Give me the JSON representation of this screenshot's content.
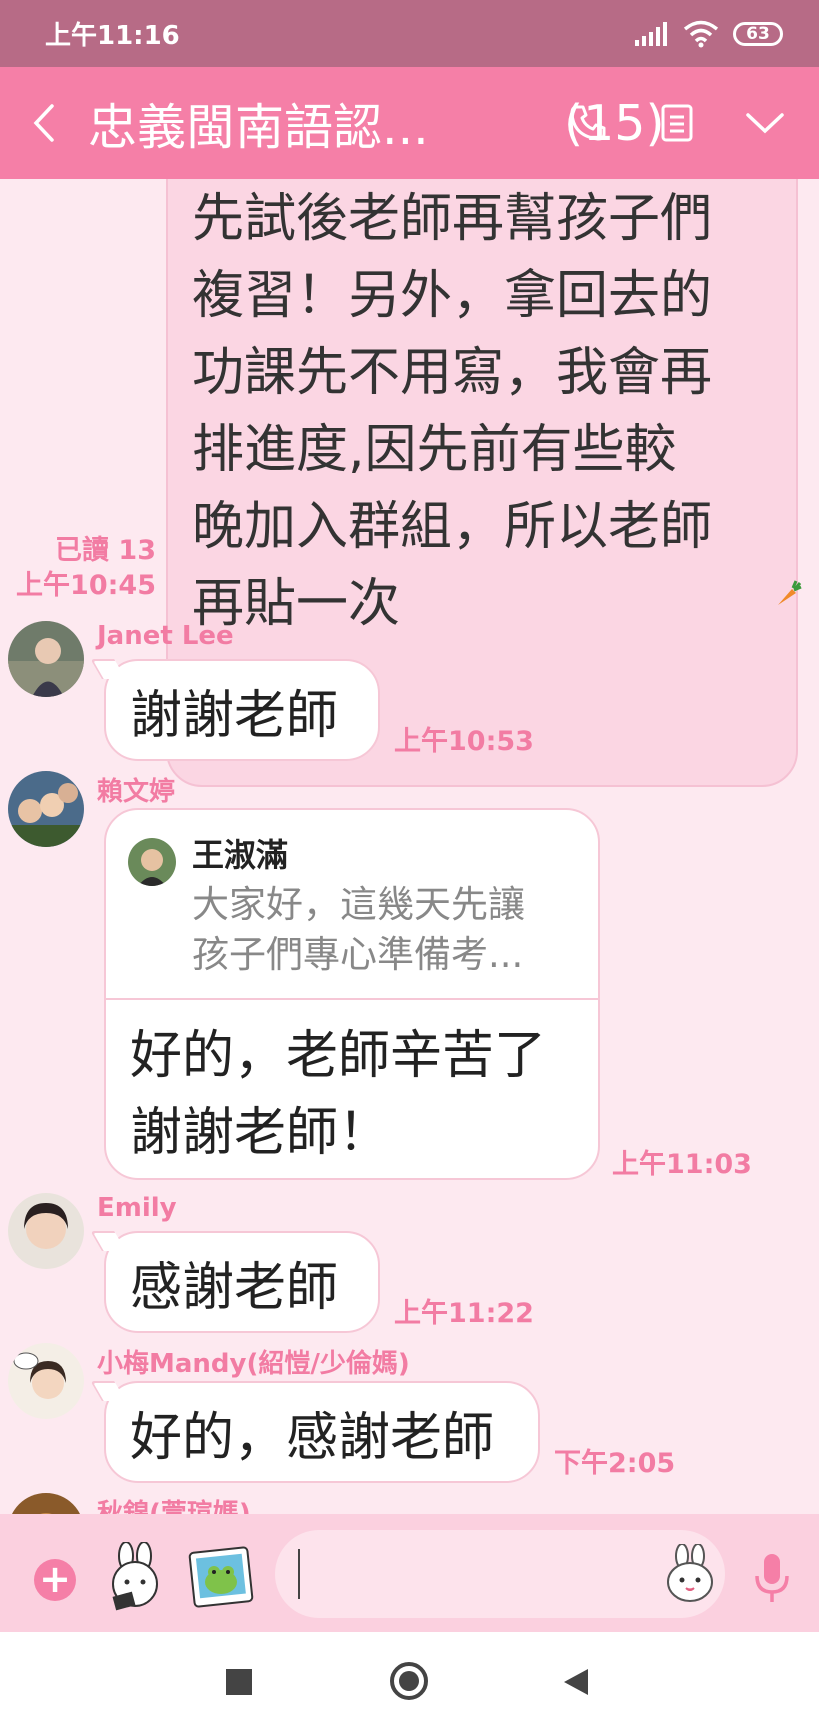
{
  "status": {
    "time": "上午11:16",
    "battery": "63"
  },
  "header": {
    "title": "忠義閩南語認...",
    "count": "(15)"
  },
  "my_message": {
    "lines": [
      "先試後老師再幫孩子們",
      "複習！另外，拿回去的",
      "功課先不用寫，我會再",
      "排進度,因先前有些較",
      "晚加入群組，所以老師",
      "再貼一次"
    ],
    "read": "已讀 13",
    "time": "上午10:45"
  },
  "messages": [
    {
      "sender": "Janet Lee",
      "text": "謝謝老師",
      "time": "上午10:53"
    },
    {
      "sender": "賴文婷",
      "quote_name": "王淑滿",
      "quote_text": "大家好，這幾天先讓\n孩子們專心準備考...",
      "text": "好的，老師辛苦了\n謝謝老師！",
      "time": "上午11:03"
    },
    {
      "sender": "Emily",
      "text": "感謝老師",
      "time": "上午11:22"
    },
    {
      "sender": "小梅Mandy(紹愷/少倫媽)",
      "text": "好的，感謝老師",
      "time": "下午2:05"
    },
    {
      "sender": "秋錦(萱瑄媽)"
    }
  ],
  "input": {
    "placeholder": ""
  },
  "colors": {
    "accent": "#f57fa7",
    "status_bar": "#b76b86",
    "background": "#fde9f0"
  }
}
